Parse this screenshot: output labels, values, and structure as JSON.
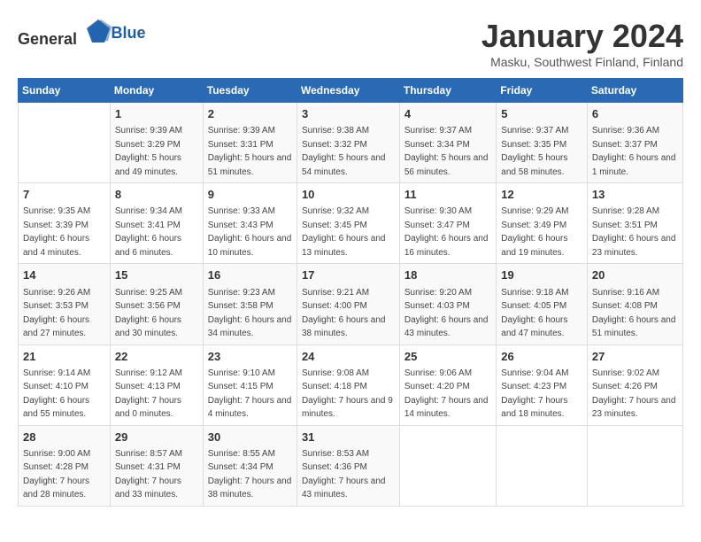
{
  "logo": {
    "general": "General",
    "blue": "Blue"
  },
  "title": "January 2024",
  "location": "Masku, Southwest Finland, Finland",
  "days_header": [
    "Sunday",
    "Monday",
    "Tuesday",
    "Wednesday",
    "Thursday",
    "Friday",
    "Saturday"
  ],
  "weeks": [
    [
      {
        "day": "",
        "sunrise": "",
        "sunset": "",
        "daylight": ""
      },
      {
        "day": "1",
        "sunrise": "Sunrise: 9:39 AM",
        "sunset": "Sunset: 3:29 PM",
        "daylight": "Daylight: 5 hours and 49 minutes."
      },
      {
        "day": "2",
        "sunrise": "Sunrise: 9:39 AM",
        "sunset": "Sunset: 3:31 PM",
        "daylight": "Daylight: 5 hours and 51 minutes."
      },
      {
        "day": "3",
        "sunrise": "Sunrise: 9:38 AM",
        "sunset": "Sunset: 3:32 PM",
        "daylight": "Daylight: 5 hours and 54 minutes."
      },
      {
        "day": "4",
        "sunrise": "Sunrise: 9:37 AM",
        "sunset": "Sunset: 3:34 PM",
        "daylight": "Daylight: 5 hours and 56 minutes."
      },
      {
        "day": "5",
        "sunrise": "Sunrise: 9:37 AM",
        "sunset": "Sunset: 3:35 PM",
        "daylight": "Daylight: 5 hours and 58 minutes."
      },
      {
        "day": "6",
        "sunrise": "Sunrise: 9:36 AM",
        "sunset": "Sunset: 3:37 PM",
        "daylight": "Daylight: 6 hours and 1 minute."
      }
    ],
    [
      {
        "day": "7",
        "sunrise": "Sunrise: 9:35 AM",
        "sunset": "Sunset: 3:39 PM",
        "daylight": "Daylight: 6 hours and 4 minutes."
      },
      {
        "day": "8",
        "sunrise": "Sunrise: 9:34 AM",
        "sunset": "Sunset: 3:41 PM",
        "daylight": "Daylight: 6 hours and 6 minutes."
      },
      {
        "day": "9",
        "sunrise": "Sunrise: 9:33 AM",
        "sunset": "Sunset: 3:43 PM",
        "daylight": "Daylight: 6 hours and 10 minutes."
      },
      {
        "day": "10",
        "sunrise": "Sunrise: 9:32 AM",
        "sunset": "Sunset: 3:45 PM",
        "daylight": "Daylight: 6 hours and 13 minutes."
      },
      {
        "day": "11",
        "sunrise": "Sunrise: 9:30 AM",
        "sunset": "Sunset: 3:47 PM",
        "daylight": "Daylight: 6 hours and 16 minutes."
      },
      {
        "day": "12",
        "sunrise": "Sunrise: 9:29 AM",
        "sunset": "Sunset: 3:49 PM",
        "daylight": "Daylight: 6 hours and 19 minutes."
      },
      {
        "day": "13",
        "sunrise": "Sunrise: 9:28 AM",
        "sunset": "Sunset: 3:51 PM",
        "daylight": "Daylight: 6 hours and 23 minutes."
      }
    ],
    [
      {
        "day": "14",
        "sunrise": "Sunrise: 9:26 AM",
        "sunset": "Sunset: 3:53 PM",
        "daylight": "Daylight: 6 hours and 27 minutes."
      },
      {
        "day": "15",
        "sunrise": "Sunrise: 9:25 AM",
        "sunset": "Sunset: 3:56 PM",
        "daylight": "Daylight: 6 hours and 30 minutes."
      },
      {
        "day": "16",
        "sunrise": "Sunrise: 9:23 AM",
        "sunset": "Sunset: 3:58 PM",
        "daylight": "Daylight: 6 hours and 34 minutes."
      },
      {
        "day": "17",
        "sunrise": "Sunrise: 9:21 AM",
        "sunset": "Sunset: 4:00 PM",
        "daylight": "Daylight: 6 hours and 38 minutes."
      },
      {
        "day": "18",
        "sunrise": "Sunrise: 9:20 AM",
        "sunset": "Sunset: 4:03 PM",
        "daylight": "Daylight: 6 hours and 43 minutes."
      },
      {
        "day": "19",
        "sunrise": "Sunrise: 9:18 AM",
        "sunset": "Sunset: 4:05 PM",
        "daylight": "Daylight: 6 hours and 47 minutes."
      },
      {
        "day": "20",
        "sunrise": "Sunrise: 9:16 AM",
        "sunset": "Sunset: 4:08 PM",
        "daylight": "Daylight: 6 hours and 51 minutes."
      }
    ],
    [
      {
        "day": "21",
        "sunrise": "Sunrise: 9:14 AM",
        "sunset": "Sunset: 4:10 PM",
        "daylight": "Daylight: 6 hours and 55 minutes."
      },
      {
        "day": "22",
        "sunrise": "Sunrise: 9:12 AM",
        "sunset": "Sunset: 4:13 PM",
        "daylight": "Daylight: 7 hours and 0 minutes."
      },
      {
        "day": "23",
        "sunrise": "Sunrise: 9:10 AM",
        "sunset": "Sunset: 4:15 PM",
        "daylight": "Daylight: 7 hours and 4 minutes."
      },
      {
        "day": "24",
        "sunrise": "Sunrise: 9:08 AM",
        "sunset": "Sunset: 4:18 PM",
        "daylight": "Daylight: 7 hours and 9 minutes."
      },
      {
        "day": "25",
        "sunrise": "Sunrise: 9:06 AM",
        "sunset": "Sunset: 4:20 PM",
        "daylight": "Daylight: 7 hours and 14 minutes."
      },
      {
        "day": "26",
        "sunrise": "Sunrise: 9:04 AM",
        "sunset": "Sunset: 4:23 PM",
        "daylight": "Daylight: 7 hours and 18 minutes."
      },
      {
        "day": "27",
        "sunrise": "Sunrise: 9:02 AM",
        "sunset": "Sunset: 4:26 PM",
        "daylight": "Daylight: 7 hours and 23 minutes."
      }
    ],
    [
      {
        "day": "28",
        "sunrise": "Sunrise: 9:00 AM",
        "sunset": "Sunset: 4:28 PM",
        "daylight": "Daylight: 7 hours and 28 minutes."
      },
      {
        "day": "29",
        "sunrise": "Sunrise: 8:57 AM",
        "sunset": "Sunset: 4:31 PM",
        "daylight": "Daylight: 7 hours and 33 minutes."
      },
      {
        "day": "30",
        "sunrise": "Sunrise: 8:55 AM",
        "sunset": "Sunset: 4:34 PM",
        "daylight": "Daylight: 7 hours and 38 minutes."
      },
      {
        "day": "31",
        "sunrise": "Sunrise: 8:53 AM",
        "sunset": "Sunset: 4:36 PM",
        "daylight": "Daylight: 7 hours and 43 minutes."
      },
      {
        "day": "",
        "sunrise": "",
        "sunset": "",
        "daylight": ""
      },
      {
        "day": "",
        "sunrise": "",
        "sunset": "",
        "daylight": ""
      },
      {
        "day": "",
        "sunrise": "",
        "sunset": "",
        "daylight": ""
      }
    ]
  ]
}
